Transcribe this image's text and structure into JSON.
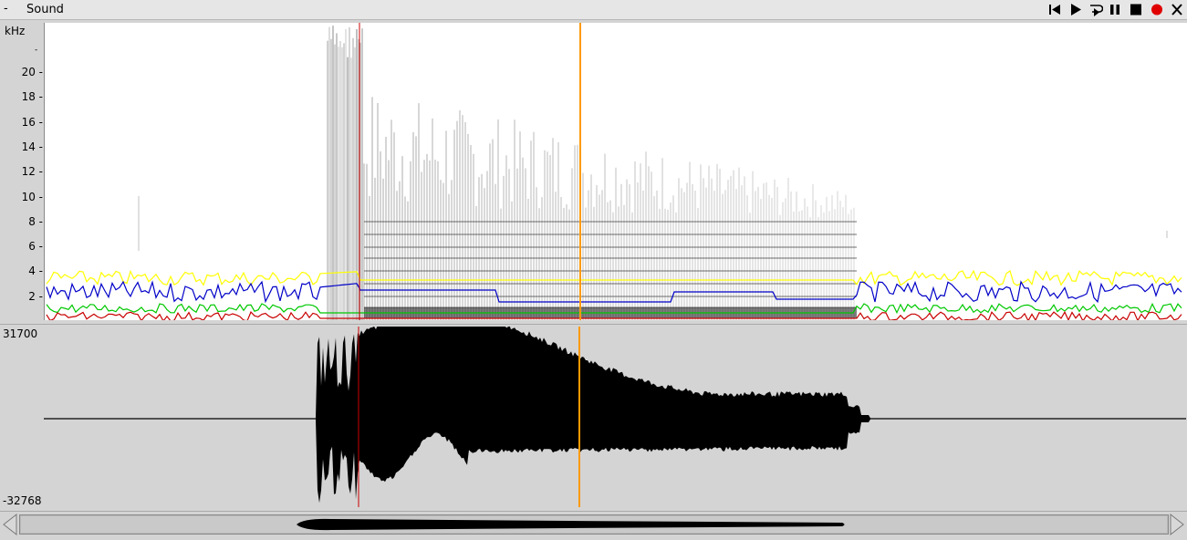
{
  "window": {
    "menu_glyph": "-",
    "title": "Sound"
  },
  "toolbar": {
    "buttons": [
      {
        "name": "skip-to-start",
        "icon": "skip-start-icon"
      },
      {
        "name": "play",
        "icon": "play-icon"
      },
      {
        "name": "loop-play",
        "icon": "loop-play-icon"
      },
      {
        "name": "pause",
        "icon": "pause-icon"
      },
      {
        "name": "stop",
        "icon": "stop-icon"
      },
      {
        "name": "record",
        "icon": "record-icon",
        "color": "#e00000"
      },
      {
        "name": "close",
        "icon": "close-icon"
      }
    ]
  },
  "spectrogram": {
    "unit_label": "kHz",
    "ticks": [
      "20",
      "18",
      "16",
      "14",
      "12",
      "10",
      "8",
      "6",
      "4",
      "2"
    ],
    "formant_colors": [
      "#ffff00",
      "#0000c8",
      "#00c800",
      "#c80000"
    ],
    "cursor_color": "#ff9900",
    "marker_color": "#cc0000"
  },
  "waveform": {
    "max_label": "31700",
    "min_label": "-32768"
  },
  "scrollbar": {
    "left_arrow": "scroll-left-icon",
    "right_arrow": "scroll-right-icon"
  }
}
